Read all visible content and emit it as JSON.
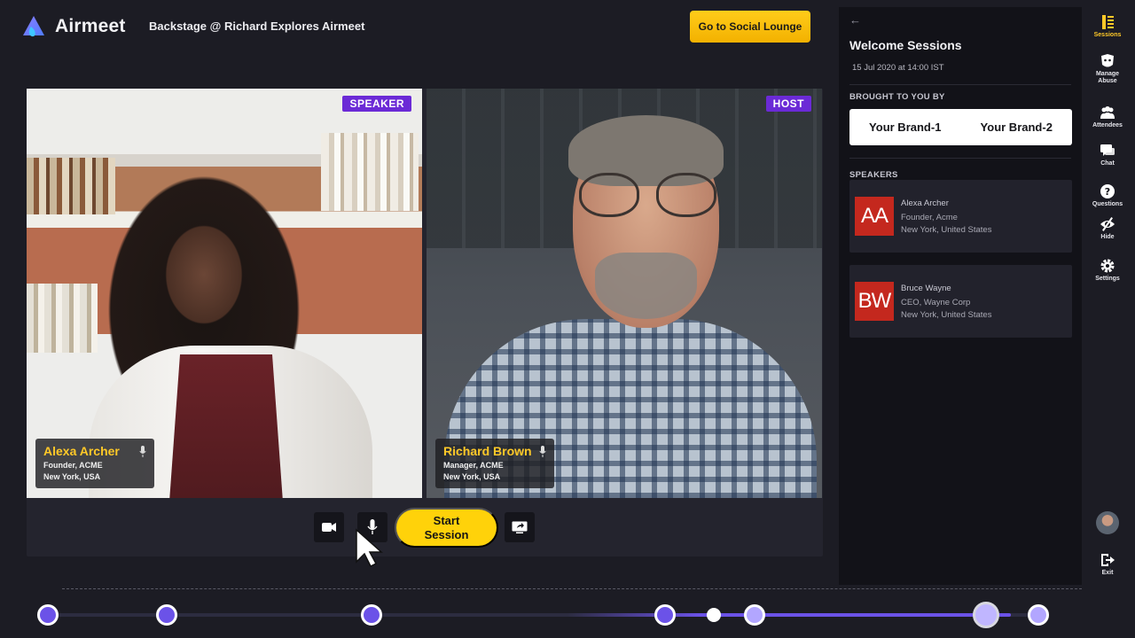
{
  "app": {
    "name": "Airmeet"
  },
  "header": {
    "event_title": "Backstage @ Richard Explores Airmeet",
    "lounge_button": "Go to Social Lounge"
  },
  "stage": {
    "tiles": [
      {
        "badge": "SPEAKER",
        "name": "Alexa Archer",
        "role": "Founder, ACME",
        "location": "New York, USA"
      },
      {
        "badge": "HOST",
        "name": "Richard Brown",
        "role": "Manager, ACME",
        "location": "New York, USA"
      }
    ],
    "start_button": "Start\nSession"
  },
  "panel": {
    "title": "Welcome Sessions",
    "date": "15 Jul 2020 at 14:00 IST",
    "sponsors_label": "BROUGHT TO YOU BY",
    "sponsors": [
      "Your Brand-1",
      "Your Brand-2"
    ],
    "speakers_label": "SPEAKERS",
    "speakers": [
      {
        "initials": "AA",
        "name": "Alexa Archer",
        "role": "Founder, Acme",
        "location": "New York, United States"
      },
      {
        "initials": "BW",
        "name": "Bruce Wayne",
        "role": "CEO, Wayne Corp",
        "location": "New York, United States"
      }
    ]
  },
  "rail": {
    "items": [
      "Sessions",
      "Manage\nAbuse",
      "Attendees",
      "Chat",
      "Questions",
      "Hide",
      "Settings"
    ],
    "exit": "Exit"
  },
  "colors": {
    "accent_yellow": "#ffc928",
    "brand_purple": "#6b2ad6",
    "timeline_purple": "#6b52e8",
    "avatar_red": "#c4281e"
  }
}
